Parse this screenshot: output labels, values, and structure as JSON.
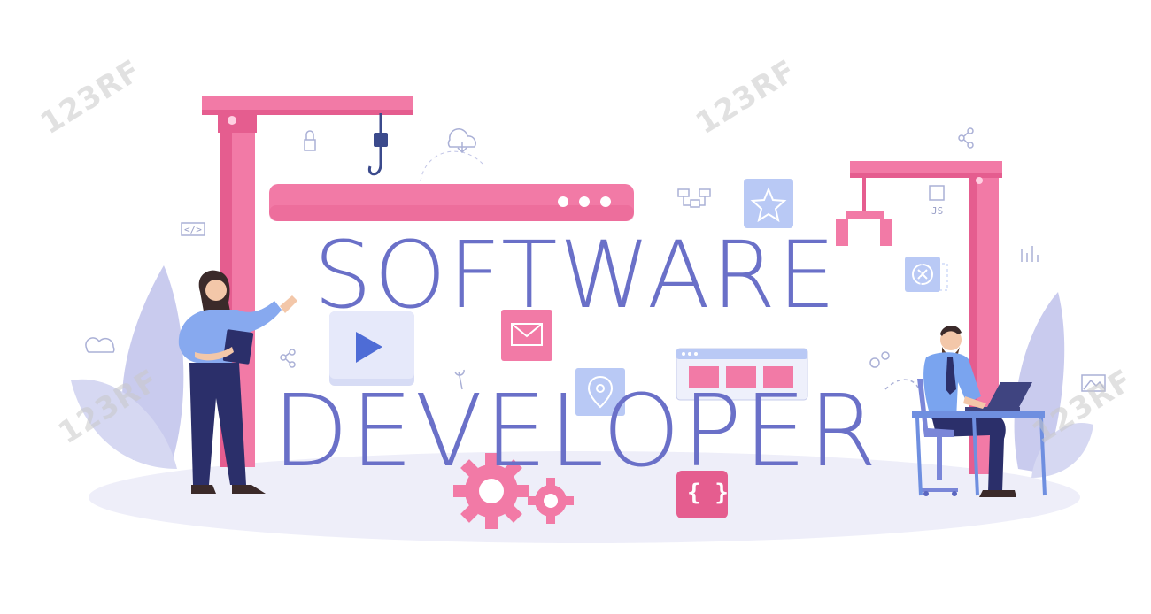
{
  "headline": {
    "line1": "SOFTWARE",
    "line2": "DEVELOPER"
  },
  "watermark": "123RF",
  "icon_labels": {
    "code": "</>",
    "js": "JS",
    "braces": "{ }"
  },
  "colors": {
    "text": "#6a70c8",
    "pink": "#f27aa6",
    "pink_dark": "#e55d8f",
    "floor": "#eeeef9",
    "leaf": "#c6c8ea",
    "navy": "#2b2f6a",
    "blue_shirt": "#6f9be8"
  },
  "icons": [
    "crane-left",
    "crane-right",
    "browser-bar",
    "star-card",
    "play-button",
    "mail-card",
    "location-card",
    "browser-window",
    "gear-large",
    "gear-small",
    "code-braces-card",
    "cloud-icon",
    "lock-icon",
    "share-icon",
    "download-cloud-icon",
    "network-icon",
    "chart-icon",
    "settings-icon",
    "wrench-icon",
    "image-icon",
    "close-card"
  ]
}
